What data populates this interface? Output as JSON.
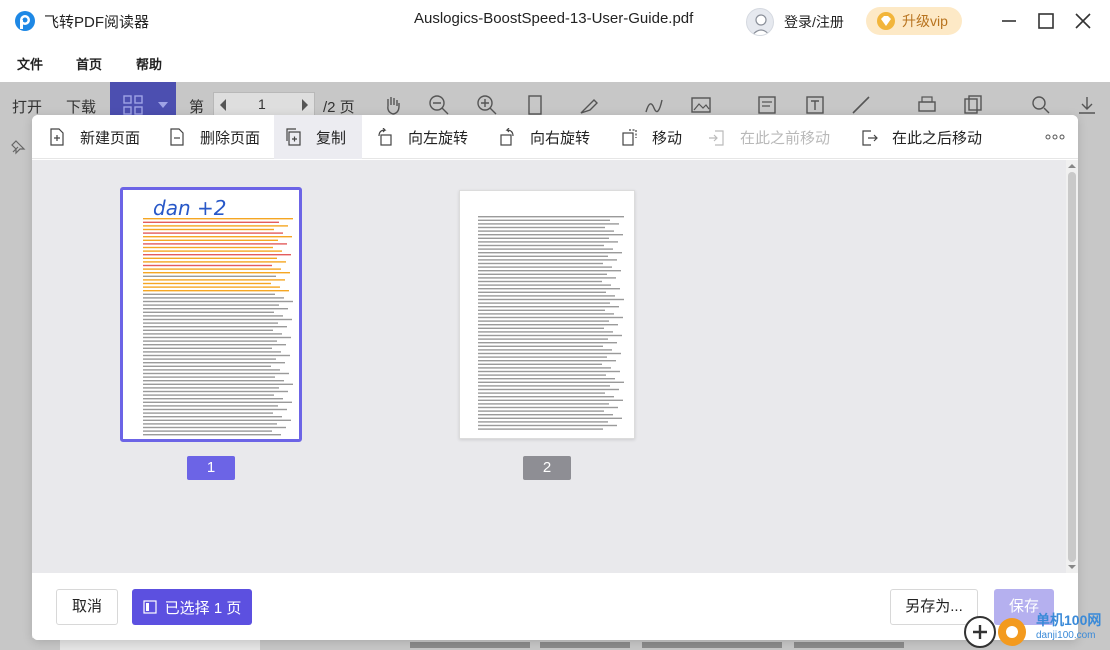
{
  "app": {
    "name": "飞转PDF阅读器",
    "document_title": "Auslogics-BoostSpeed-13-User-Guide.pdf",
    "login": "登录/注册",
    "upgrade": "升级vip"
  },
  "menu": [
    "文件",
    "首页",
    "帮助"
  ],
  "toolbar": {
    "open": "打开",
    "download": "下载",
    "page_prefix": "第",
    "current_page": "1",
    "page_total": "/2 页"
  },
  "modal": {
    "tools": [
      {
        "label": "新建页面",
        "icon": "new-page-icon",
        "state": "normal"
      },
      {
        "label": "删除页面",
        "icon": "delete-page-icon",
        "state": "normal"
      },
      {
        "label": "复制",
        "icon": "copy-icon",
        "state": "active"
      },
      {
        "label": "向左旋转",
        "icon": "rotate-left-icon",
        "state": "normal"
      },
      {
        "label": "向右旋转",
        "icon": "rotate-right-icon",
        "state": "normal"
      },
      {
        "label": "移动",
        "icon": "move-icon",
        "state": "normal"
      },
      {
        "label": "在此之前移动",
        "icon": "move-before-icon",
        "state": "disabled"
      },
      {
        "label": "在此之后移动",
        "icon": "move-after-icon",
        "state": "normal"
      }
    ],
    "thumbnails": [
      {
        "label": "1",
        "selected": true,
        "handwriting": "dan +2"
      },
      {
        "label": "2",
        "selected": false
      }
    ],
    "footer": {
      "cancel": "取消",
      "selected": "已选择 1 页",
      "save_as": "另存为...",
      "save": "保存"
    }
  },
  "watermark": {
    "text": "单机100网",
    "sub": "danji100.com"
  },
  "colors": {
    "accent": "#5c50e0",
    "selection_border": "#6c64e6",
    "vip_bg": "#fde9c6",
    "vip_text": "#b8731e",
    "highlight_orange": "#f5a623",
    "highlight_red": "#e35d5d"
  }
}
